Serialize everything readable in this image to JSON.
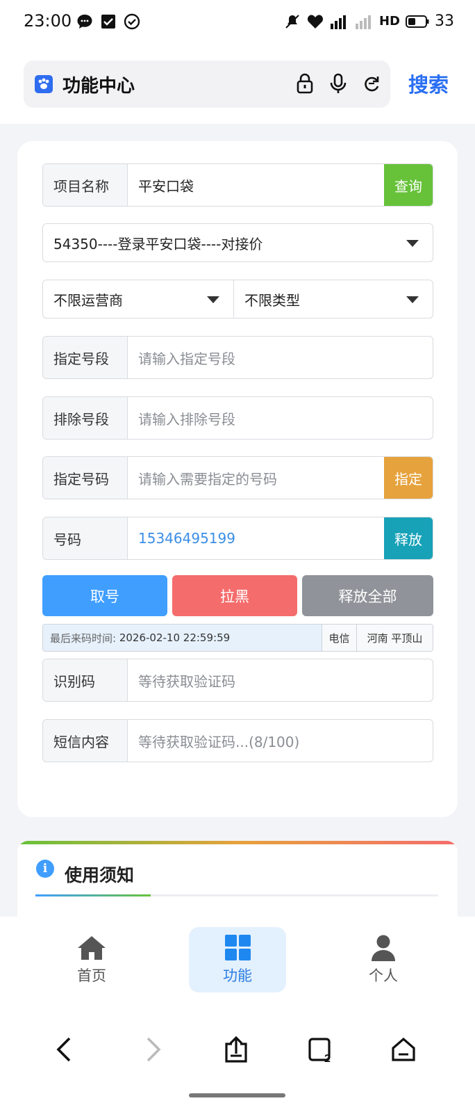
{
  "status_bar": {
    "time": "23:00",
    "network": "HD",
    "battery": "33"
  },
  "browser": {
    "address_title": "功能中心",
    "search_label": "搜索"
  },
  "form": {
    "project": {
      "label": "项目名称",
      "value": "平安口袋",
      "button": "查询"
    },
    "item_select": "54350----登录平安口袋----对接价",
    "carrier_select": "不限运营商",
    "type_select": "不限类型",
    "segment": {
      "label": "指定号段",
      "placeholder": "请输入指定号段"
    },
    "exclude": {
      "label": "排除号段",
      "placeholder": "请输入排除号段"
    },
    "specify": {
      "label": "指定号码",
      "placeholder": "请输入需要指定的号码",
      "button": "指定"
    },
    "number": {
      "label": "号码",
      "value": "15346495199",
      "button": "释放"
    },
    "actions": {
      "get": "取号",
      "block": "拉黑",
      "release_all": "释放全部"
    },
    "info": {
      "last_label": "最后来码时间:",
      "last_time": "2026-02-10 22:59:59",
      "carrier": "电信",
      "region": "河南 平顶山"
    },
    "code": {
      "label": "识别码",
      "placeholder": "等待获取验证码"
    },
    "sms": {
      "label": "短信内容",
      "placeholder": "等待获取验证码...(8/100)"
    }
  },
  "notice": {
    "icon": "i",
    "title": "使用须知"
  },
  "tabs": [
    {
      "label": "首页",
      "icon": "home-icon"
    },
    {
      "label": "功能",
      "icon": "grid-icon"
    },
    {
      "label": "个人",
      "icon": "person-icon"
    }
  ],
  "colors": {
    "query_green": "#67c23a",
    "specify_orange": "#e6a23c",
    "release_teal": "#17a2b8",
    "get_blue": "#409eff",
    "block_red": "#f56c6c",
    "release_all_gray": "#909399",
    "link_blue": "#2a6ff2"
  }
}
